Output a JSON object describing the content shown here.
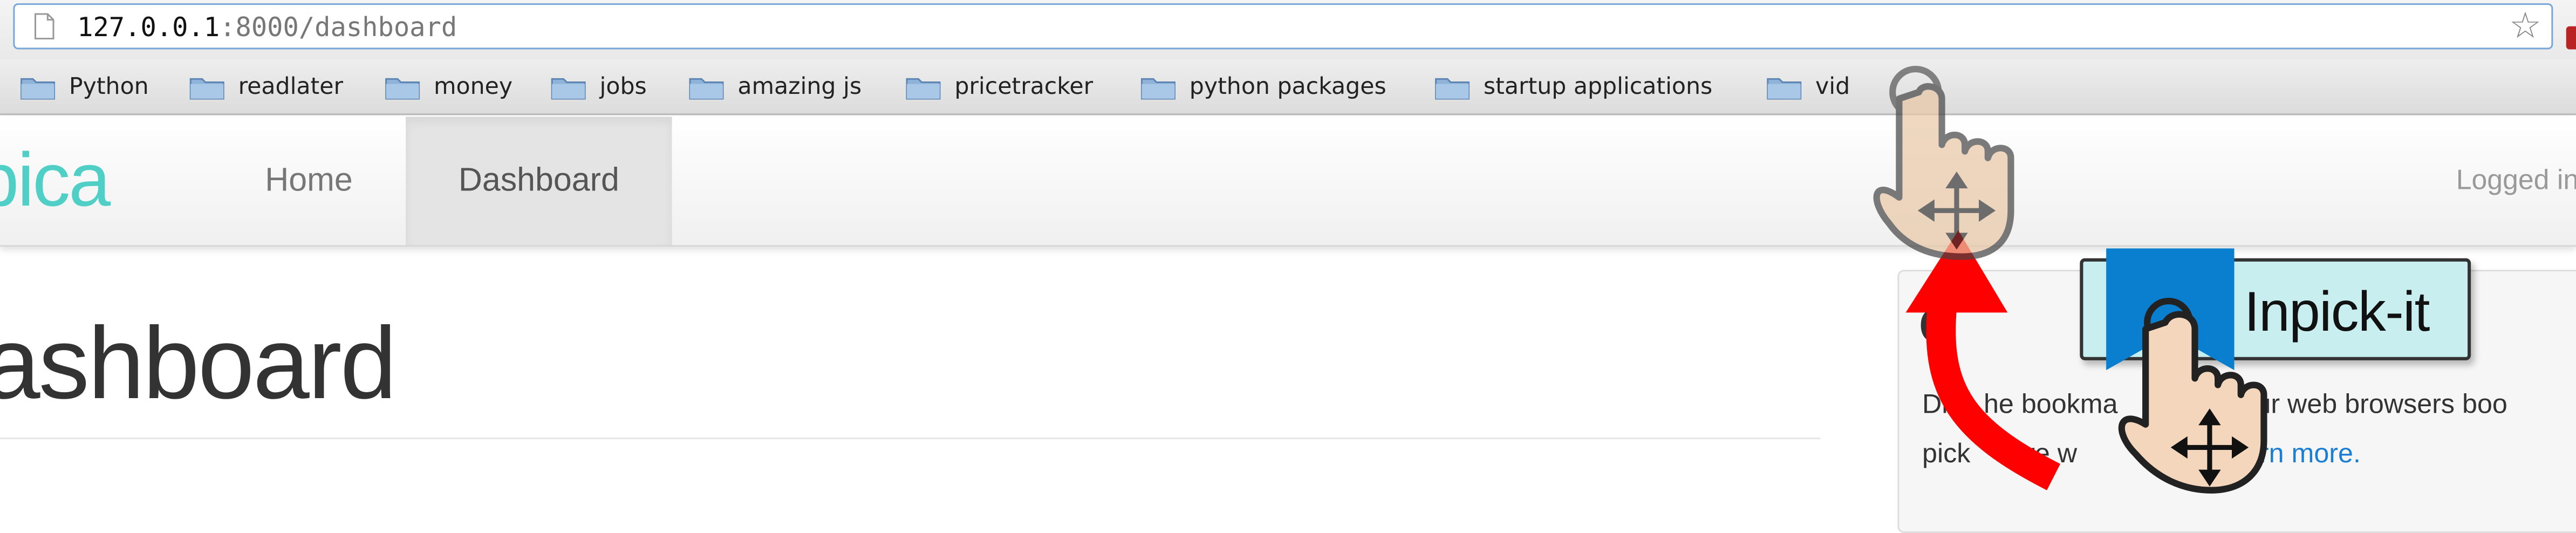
{
  "browser": {
    "url_host": "127.0.0.1",
    "url_rest": ":8000/dashboard"
  },
  "bookmarks": [
    {
      "label": "Python"
    },
    {
      "label": "readlater"
    },
    {
      "label": "money"
    },
    {
      "label": "jobs"
    },
    {
      "label": "amazing js"
    },
    {
      "label": "pricetracker"
    },
    {
      "label": "python packages"
    },
    {
      "label": "startup applications"
    },
    {
      "label": "vid"
    }
  ],
  "nav": {
    "brand": "pica",
    "home": "Home",
    "dashboard": "Dashboard",
    "logged_in": "Logged in"
  },
  "page": {
    "title": "ashboard"
  },
  "panel": {
    "heading_char": "G",
    "line1_a": "Dr",
    "line1_b": "he bookma",
    "line1_c": " your web browsers boo",
    "line2_a": "pick ",
    "line2_b": "ure w",
    "line2_c": "owse. ",
    "link": "Learn more."
  },
  "bookmarklet": {
    "label": "Inpick-it"
  },
  "colors": {
    "brand": "#4fcfc6",
    "link": "#1a7fd4",
    "arrow": "#ff0000",
    "ribbon": "#0a7ecf",
    "bookmarklet_bg": "#c9eef0",
    "hand": "#f3d6bb"
  },
  "icons": [
    "page-icon",
    "star-icon",
    "folder-icon",
    "pointer-hand-icon",
    "move-cross-icon",
    "ribbon-icon",
    "curved-arrow-icon"
  ]
}
